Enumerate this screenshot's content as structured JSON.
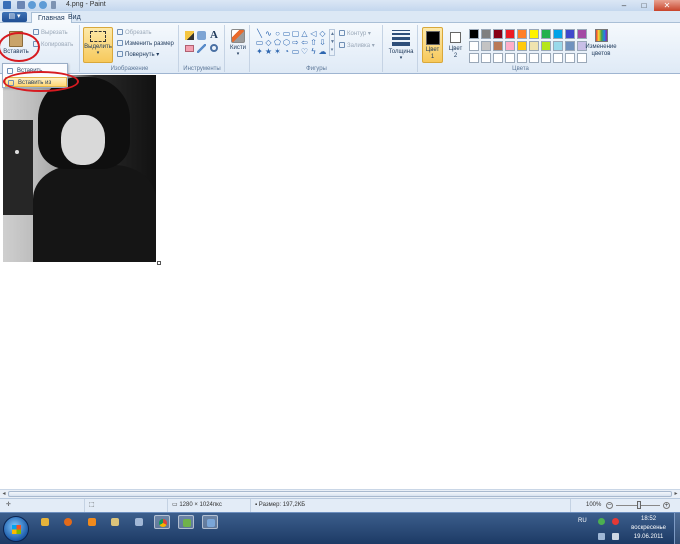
{
  "window": {
    "title": "4.png - Paint",
    "controls": {
      "minimize": "–",
      "maximize": "□",
      "close": "✕"
    }
  },
  "tabs": {
    "file_menu_icon": "▤ ▾",
    "items": [
      "Главная",
      "Вид"
    ]
  },
  "clipboard": {
    "paste_label": "Вставить",
    "cut_label": "Вырезать",
    "copy_label": "Копировать"
  },
  "image_group": {
    "select_label": "Выделить",
    "crop_label": "Обрезать",
    "resize_label": "Изменить размер",
    "rotate_label": "Повернуть",
    "group_label": "Изображение"
  },
  "tools_group": {
    "group_label": "Инструменты",
    "text_tool": "A"
  },
  "brushes": {
    "label": "Кисти"
  },
  "shapes_group": {
    "outline_label": "Контур",
    "fill_label": "Заливка",
    "group_label": "Фигуры",
    "shapes": [
      "╲",
      "∿",
      "○",
      "▭",
      "▢",
      "△",
      "◁",
      "◇",
      "▭",
      "◇",
      "⬠",
      "⬡",
      "⇨",
      "⇦",
      "⇧",
      "⇩",
      "✦",
      "★",
      "✶",
      "◔",
      "▭",
      "♡",
      "ϟ",
      "☁"
    ]
  },
  "size": {
    "label": "Толщина"
  },
  "colors": {
    "color1_label": "Цвет 1",
    "color2_label": "Цвет 2",
    "edit_colors_label": "Изменение цветов",
    "group_label": "Цвета",
    "color1": "#000000",
    "color2": "#ffffff",
    "palette": [
      "#000000",
      "#7f7f7f",
      "#880015",
      "#ed1c24",
      "#ff7f27",
      "#fff200",
      "#22b14c",
      "#00a2e8",
      "#3f48cc",
      "#a349a4",
      "#ffffff",
      "#c3c3c3",
      "#b97a57",
      "#ffaec9",
      "#ffc90e",
      "#efe4b0",
      "#b5e61d",
      "#99d9ea",
      "#7092be",
      "#c8bfe7",
      "#ffffff",
      "#ffffff",
      "#ffffff",
      "#ffffff",
      "#ffffff",
      "#ffffff",
      "#ffffff",
      "#ffffff",
      "#ffffff",
      "#ffffff"
    ]
  },
  "paste_menu": {
    "items": [
      "Вставить",
      "Вставить из"
    ]
  },
  "status": {
    "dimensions": "1280 × 1024пкс",
    "size": "Размер: 197,2КБ",
    "zoom": "100%"
  },
  "taskbar": {
    "language": "RU",
    "time": "18:52",
    "day": "воскресенье",
    "date": "19.06.2011"
  }
}
